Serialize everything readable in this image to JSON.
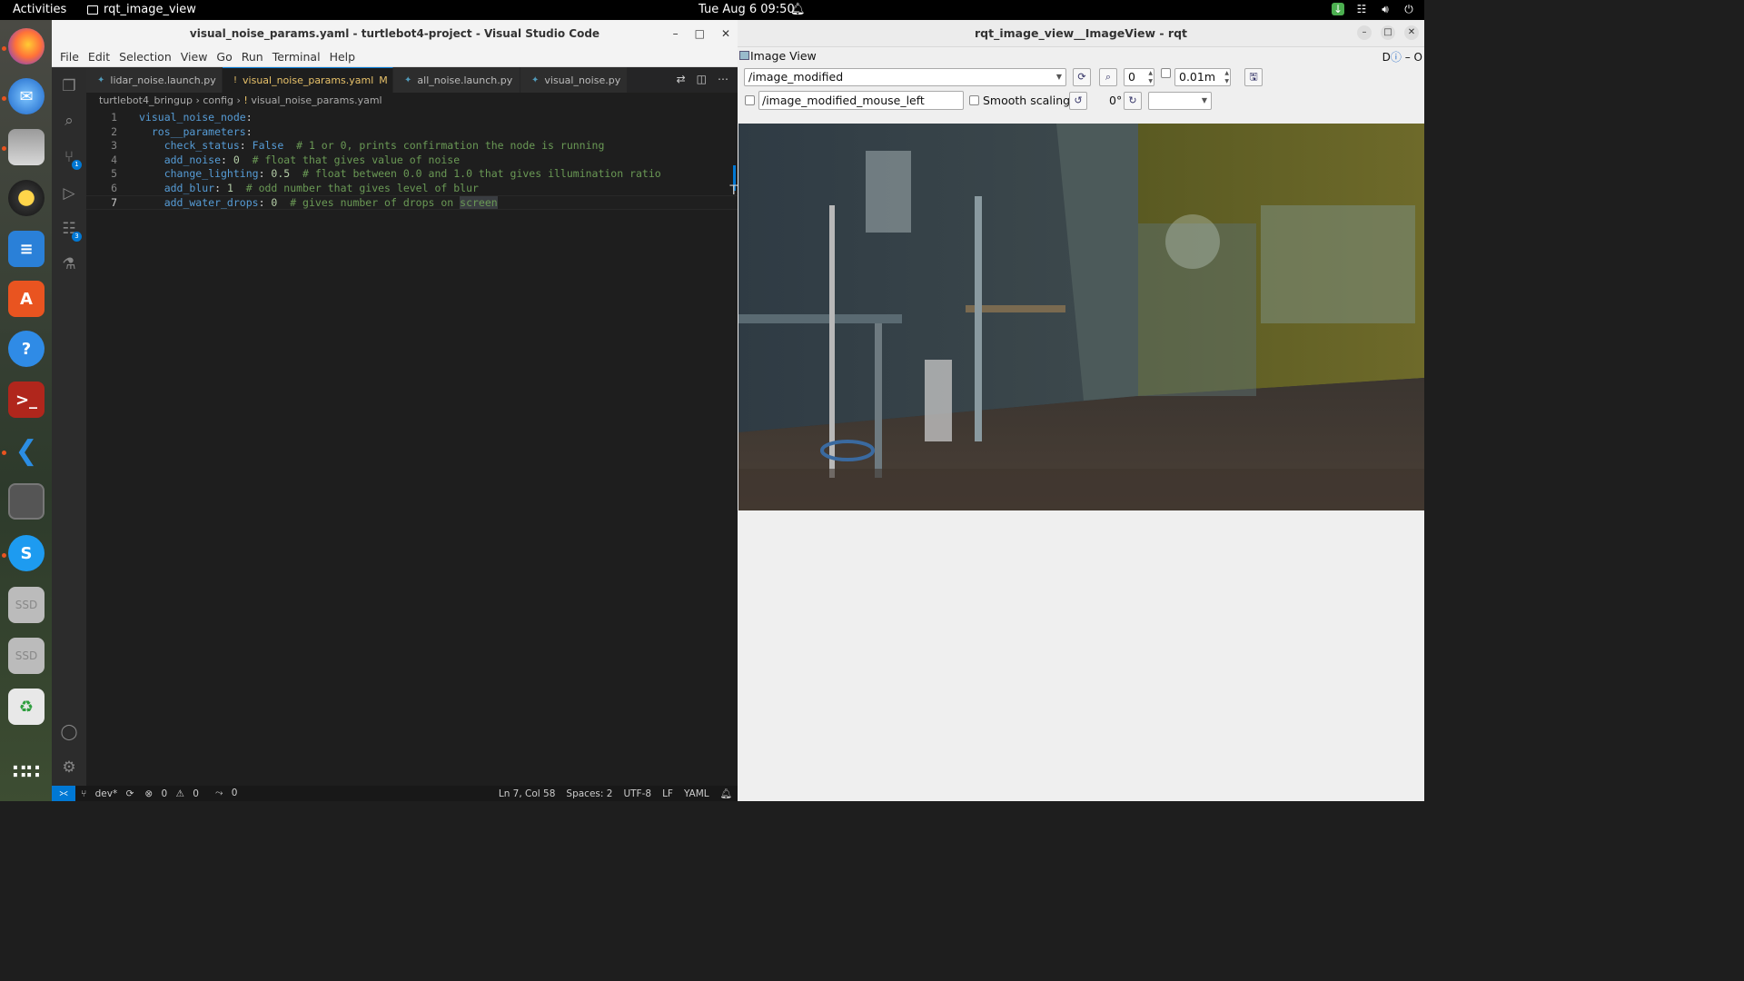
{
  "topbar": {
    "activities": "Activities",
    "app_name": "rqt_image_view",
    "clock": "Tue Aug 6  09:50"
  },
  "dock": {
    "items": [
      "firefox-icon",
      "thunderbird-icon",
      "files-icon",
      "rhythmbox-icon",
      "writer-icon",
      "app-center-icon",
      "help-icon",
      "terminal-icon",
      "vscode-icon",
      "image-viewer-icon",
      "skype-icon",
      "ssd-drive-icon",
      "ssd-drive-icon",
      "trash-icon",
      "show-apps-icon"
    ],
    "ssd_label": "SSD"
  },
  "vscode": {
    "title": "visual_noise_params.yaml - turtlebot4-project - Visual Studio Code",
    "menu": [
      "File",
      "Edit",
      "Selection",
      "View",
      "Go",
      "Run",
      "Terminal",
      "Help"
    ],
    "tabs": [
      {
        "label": "lidar_noise.launch.py",
        "icon": "python-icon"
      },
      {
        "label": "visual_noise_params.yaml",
        "icon": "yaml-icon",
        "modified": "M",
        "active": true
      },
      {
        "label": "all_noise.launch.py",
        "icon": "python-icon"
      },
      {
        "label": "visual_noise.py",
        "icon": "python-icon"
      }
    ],
    "breadcrumb": [
      "turtlebot4_bringup",
      "config",
      "visual_noise_params.yaml"
    ],
    "badges": {
      "source_control": "1",
      "extensions": "3"
    },
    "code": [
      {
        "n": "1",
        "key": "visual_noise_node",
        "sep": ":",
        "val": "",
        "comment": ""
      },
      {
        "n": "2",
        "key": "  ros__parameters",
        "sep": ":",
        "val": "",
        "comment": ""
      },
      {
        "n": "3",
        "key": "    check_status",
        "sep": ": ",
        "val": "False",
        "comment": "  # 1 or 0, prints confirmation the node is running"
      },
      {
        "n": "4",
        "key": "    add_noise",
        "sep": ": ",
        "val": "0",
        "comment": "  # float that gives value of noise"
      },
      {
        "n": "5",
        "key": "    change_lighting",
        "sep": ": ",
        "val": "0.5",
        "comment": "  # float between 0.0 and 1.0 that gives illumination ratio"
      },
      {
        "n": "6",
        "key": "    add_blur",
        "sep": ": ",
        "val": "1",
        "comment": "  # odd number that gives level of blur"
      },
      {
        "n": "7",
        "key": "    add_water_drops",
        "sep": ": ",
        "val": "0",
        "comment": "  # gives number of drops on ",
        "highlight": "screen"
      }
    ],
    "status": {
      "branch": "dev*",
      "errors": "0",
      "warnings": "0",
      "ports": "0",
      "position": "Ln 7, Col 58",
      "spaces": "Spaces: 2",
      "encoding": "UTF-8",
      "eol": "LF",
      "language": "YAML"
    }
  },
  "rqt": {
    "title": "rqt_image_view__ImageView - rqt",
    "dock_title": "Image View",
    "dock_right": "D",
    "topic": "/image_modified",
    "zoom_value": "0",
    "time_value": "0.01m",
    "mouse_topic": "/image_modified_mouse_left",
    "smooth_scaling": "Smooth scaling",
    "rotation": "0°",
    "rotation_combo": ""
  }
}
